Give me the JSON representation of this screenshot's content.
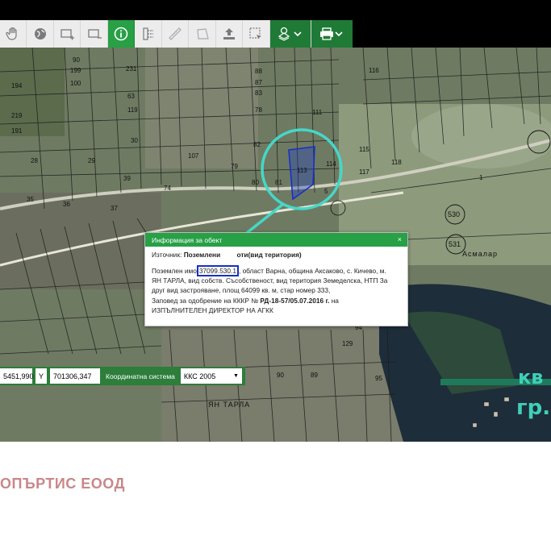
{
  "toolbar": {
    "buttons": [
      {
        "icon": "hand-icon"
      },
      {
        "icon": "globe-icon"
      },
      {
        "icon": "add-area-icon"
      },
      {
        "icon": "remove-area-icon"
      },
      {
        "icon": "info-icon",
        "active": true
      },
      {
        "icon": "ruler-select-icon"
      },
      {
        "icon": "measure-icon"
      },
      {
        "icon": "polygon-icon"
      },
      {
        "icon": "upload-icon"
      },
      {
        "icon": "select-area-icon"
      },
      {
        "icon": "layers-dropdown-icon"
      },
      {
        "icon": "print-dropdown-icon"
      }
    ],
    "accent": "#27a046"
  },
  "map": {
    "plot_labels": [
      "90",
      "100",
      "231",
      "63",
      "199",
      "88",
      "87",
      "119",
      "194",
      "83",
      "219",
      "191",
      "28",
      "29",
      "30",
      "107",
      "78",
      "79",
      "82",
      "111",
      "113",
      "114",
      "115",
      "116",
      "118",
      "35",
      "36",
      "37",
      "39",
      "74",
      "80",
      "81",
      "117",
      "1",
      "530",
      "531",
      "5",
      "129",
      "94",
      "95",
      "90",
      "89"
    ],
    "street_label": "Асмалар",
    "district_label": "ЯН ТАРЛА",
    "overlay_top": "кв",
    "overlay_bottom": "гр."
  },
  "popup": {
    "title": "Информация за обект",
    "close": "×",
    "source_label": "Източник:",
    "source_value": "Поземлени имоти(вид територия)",
    "source_visible": "Поземлени ",
    "source_visible_end": "оти(вид територия)",
    "line1_pre": "Поземлен имо",
    "plot_id": "37099.530.1",
    "line1_post": ", област Варна, община Аксаково, с. Кичево, м.",
    "line2": "ЯН ТАРЛА, вид собств. Съсобственост, вид територия Земеделска, НТП За",
    "line3": "друг вид застрояване, площ 64099 кв. м, стар номер 333,",
    "line4_pre": "Заповед за одобрение на КККР № ",
    "line4_order": "РД-18-57/05.07.2016 г.",
    "line4_post": " на",
    "line5": "ИЗПЪЛНИТЕЛЕН ДИРЕКТОР НА АГКК"
  },
  "coords": {
    "x_value": "5451,990",
    "y_label": "Y",
    "y_value": "701306,347",
    "system_label": "Координатна система",
    "system_value": "ККС 2005"
  },
  "footer": {
    "company": "ОПЪРТИС ЕООД"
  }
}
